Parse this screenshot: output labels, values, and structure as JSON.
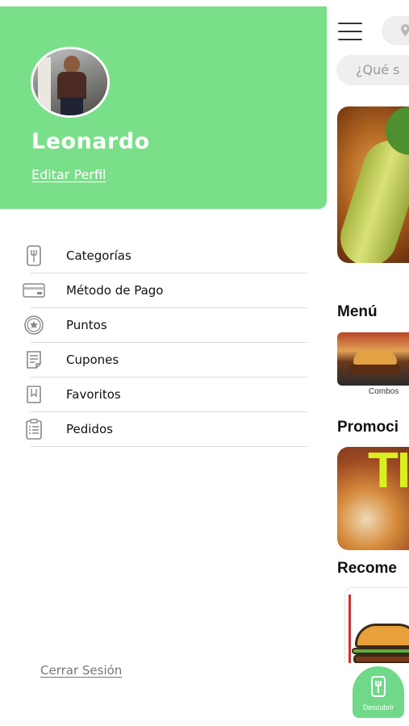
{
  "drawer": {
    "user": {
      "name": "Leonardo",
      "edit_profile": "Editar Perfil"
    },
    "items": [
      {
        "label": "Categorías",
        "icon": "fork-knife-icon"
      },
      {
        "label": "Método de Pago",
        "icon": "credit-card-icon"
      },
      {
        "label": "Puntos",
        "icon": "star-badge-icon"
      },
      {
        "label": "Cupones",
        "icon": "coupon-icon"
      },
      {
        "label": "Favoritos",
        "icon": "bookmark-icon"
      },
      {
        "label": "Pedidos",
        "icon": "clipboard-icon"
      }
    ],
    "logout": "Cerrar Sesión"
  },
  "main": {
    "search": {
      "placeholder": "¿Qué s"
    },
    "sections": {
      "menu": "Menú",
      "promos": "Promoci",
      "recommended": "Recome"
    },
    "menu_caption": "Combos",
    "promo_text": "TI",
    "bottom_nav": {
      "discover": "Descubrir"
    }
  },
  "colors": {
    "accent_green": "#7adf89",
    "fab_green": "#6fd989",
    "promo_text": "#d9f01e"
  }
}
